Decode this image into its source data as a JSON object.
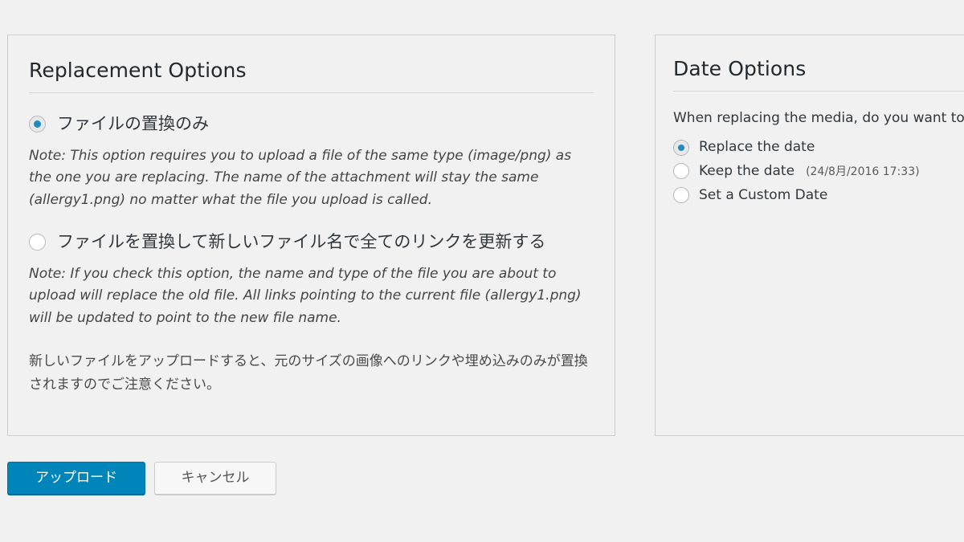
{
  "replacement_panel": {
    "title": "Replacement Options",
    "options": [
      {
        "label": "ファイルの置換のみ",
        "checked": true,
        "note": "Note: This option requires you to upload a file of the same type (image/png) as the one you are replacing. The name of the attachment will stay the same (allergy1.png) no matter what the file you upload is called."
      },
      {
        "label": "ファイルを置換して新しいファイル名で全てのリンクを更新する",
        "checked": false,
        "note": "Note: If you check this option, the name and type of the file you are about to upload will replace the old file. All links pointing to the current file (allergy1.png) will be updated to point to the new file name."
      }
    ],
    "footer_note": "新しいファイルをアップロードすると、元のサイズの画像へのリンクや埋め込みのみが置換されますのでご注意ください。"
  },
  "date_panel": {
    "title": "Date Options",
    "intro": "When replacing the media, do you want to:",
    "options": [
      {
        "label": "Replace the date",
        "checked": true,
        "subtext": ""
      },
      {
        "label": "Keep the date",
        "checked": false,
        "subtext": "(24/8月/2016 17:33)"
      },
      {
        "label": "Set a Custom Date",
        "checked": false,
        "subtext": ""
      }
    ]
  },
  "actions": {
    "submit_label": "アップロード",
    "cancel_label": "キャンセル"
  },
  "colors": {
    "accent": "#0085ba",
    "radio_dot": "#1e8cbe",
    "page_background": "#f1f1f1",
    "panel_border": "#cdcdcd",
    "text": "#32373c"
  }
}
